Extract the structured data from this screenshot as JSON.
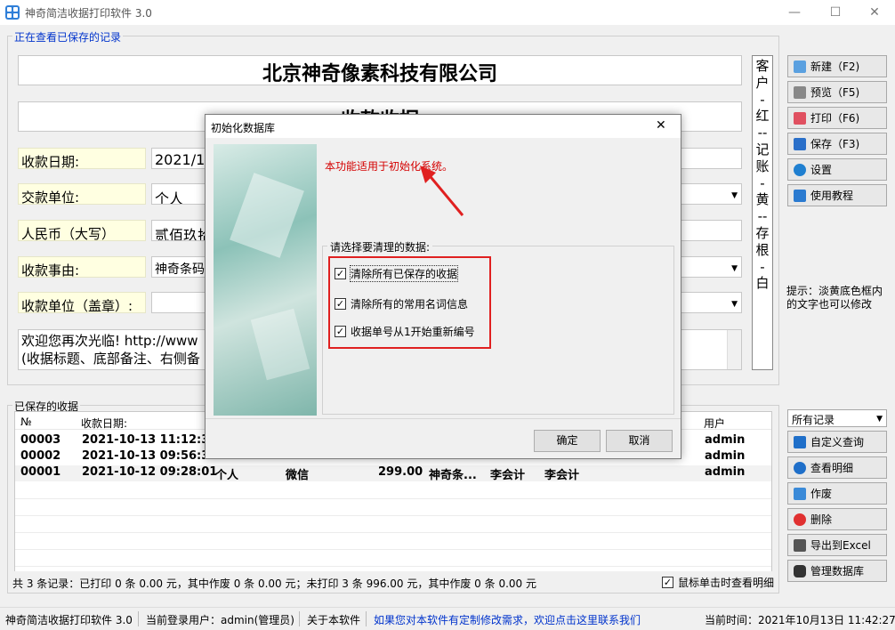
{
  "window": {
    "title": "神奇简洁收据打印软件 3.0",
    "minimize": "—",
    "maximize": "☐",
    "close": "✕"
  },
  "form": {
    "legend": "正在查看已保存的记录",
    "company": "北京神奇像素科技有限公司",
    "receipt_title": "收款收据",
    "labels": {
      "date": "收款日期:",
      "payer": "交款单位:",
      "rmb": "人民币（大写）",
      "reason": "收款事由:",
      "payee": "收款单位（盖章）:"
    },
    "values": {
      "date": "2021/10",
      "payer": "个人",
      "rmb": "贰佰玖拾",
      "reason": "神奇条码"
    },
    "note_line1": "欢迎您再次光临! http://www",
    "note_line2": "(收据标题、底部备注、右侧备"
  },
  "side_strip": [
    "客",
    "户",
    "-",
    "红",
    "--",
    "记",
    "账",
    "-",
    "黄",
    "--",
    "存",
    "根",
    "-",
    "白"
  ],
  "toolbar": {
    "new": "新建（F2)",
    "preview": "预览（F5)",
    "print": "打印（F6)",
    "save": "保存（F3)",
    "settings": "设置",
    "tutorial": "使用教程"
  },
  "hint": "提示：淡黄底色框内的文字也可以修改",
  "saved": {
    "legend": "已保存的收据",
    "headers": {
      "no": "№",
      "date": "收款日期:",
      "user": "用户"
    },
    "rows": [
      {
        "no": "00003",
        "date": "2021-10-13 11:12:33",
        "user": "admin"
      },
      {
        "no": "00002",
        "date": "2021-10-13 09:56:34",
        "user": "admin"
      },
      {
        "no": "00001",
        "date": "2021-10-12 09:28:01",
        "payer": "个人",
        "method": "微信",
        "amount": "299.00",
        "reason": "神奇条...",
        "payee": "李会计",
        "handler": "李会计",
        "user": "admin"
      }
    ],
    "summary": "共 3 条记录：已打印 0 条 0.00 元，其中作废 0 条 0.00 元；未打印 3 条 996.00 元，其中作废 0 条 0.00 元",
    "click_detail": "鼠标单击时查看明细"
  },
  "filter": {
    "selected": "所有记录"
  },
  "actions": {
    "custom_query": "自定义查询",
    "view_detail": "查看明细",
    "void": "作废",
    "delete": "删除",
    "export": "导出到Excel",
    "manage_db": "管理数据库"
  },
  "status": {
    "app": "神奇简洁收据打印软件 3.0",
    "user": "当前登录用户：admin(管理员)",
    "about": "关于本软件",
    "contact": "如果您对本软件有定制修改需求，欢迎点击这里联系我们",
    "time": "当前时间：2021年10月13日 11:42:27"
  },
  "dialog": {
    "title": "初始化数据库",
    "close": "✕",
    "notice": "本功能适用于初始化系统。",
    "group_label": "请选择要清理的数据:",
    "options": [
      "清除所有已保存的收据",
      "清除所有的常用名词信息",
      "收据单号从1开始重新编号"
    ],
    "ok": "确定",
    "cancel": "取消"
  },
  "colors": {
    "notice": "#d40000",
    "annotation": "#e02020",
    "status_link": "#0033cc"
  }
}
